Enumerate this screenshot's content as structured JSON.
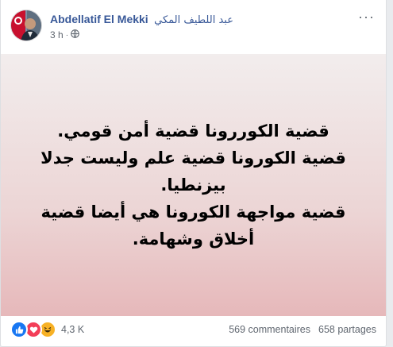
{
  "post": {
    "author_name": "Abdellatif El Mekki",
    "author_name_ar": "عبد اللطيف المكي",
    "time": "3 h",
    "time_separator": "·",
    "audience_icon": "globe-icon",
    "menu_icon": "more-options-icon",
    "text_lines": [
      "قضية الكوررونا قضية أمن قومي.",
      "قضية الكورونا قضية علم وليست جدلا بيزنطيا.",
      "قضية مواجهة الكورونا هي أيضا قضية أخلاق وشهامة."
    ],
    "background_colors": [
      "#f2eded",
      "#e6b8ba"
    ]
  },
  "footer": {
    "reactions": [
      "like-icon",
      "love-icon",
      "haha-icon"
    ],
    "reaction_count": "4,3 K",
    "comments": "569 commentaires",
    "shares": "658 partages"
  },
  "colors": {
    "link": "#385898",
    "meta": "#606770",
    "like": "#1877f2",
    "love": "#f33e58",
    "haha": "#f7b125"
  }
}
